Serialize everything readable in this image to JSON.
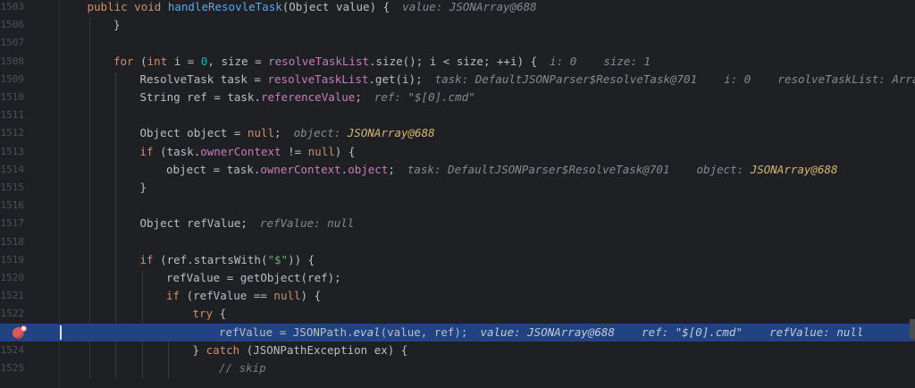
{
  "editor": {
    "lines": [
      {
        "num": "1503",
        "indent": 1,
        "tokens": [
          {
            "t": "public void ",
            "c": "kw"
          },
          {
            "t": "handleResovleTask",
            "c": "fn"
          },
          {
            "t": "(Object value) {",
            "c": "plain"
          },
          {
            "t": "value: JSONArray@688",
            "c": "hint"
          }
        ]
      },
      {
        "num": "1506",
        "indent": 2,
        "tokens": [
          {
            "t": "}",
            "c": "plain"
          }
        ]
      },
      {
        "num": "1507",
        "indent": 0,
        "tokens": []
      },
      {
        "num": "1508",
        "indent": 2,
        "tokens": [
          {
            "t": "for ",
            "c": "kw"
          },
          {
            "t": "(",
            "c": "plain"
          },
          {
            "t": "int ",
            "c": "kw"
          },
          {
            "t": "i = ",
            "c": "plain"
          },
          {
            "t": "0",
            "c": "num-lit"
          },
          {
            "t": ", size = ",
            "c": "plain"
          },
          {
            "t": "resolveTaskList",
            "c": "field"
          },
          {
            "t": ".size(); i < size; ++i) {",
            "c": "plain"
          },
          {
            "t": "i: 0    size: 1",
            "c": "hint"
          }
        ]
      },
      {
        "num": "1509",
        "indent": 3,
        "tokens": [
          {
            "t": "ResolveTask task = ",
            "c": "plain"
          },
          {
            "t": "resolveTaskList",
            "c": "field"
          },
          {
            "t": ".get(i);",
            "c": "plain"
          },
          {
            "t": "task: DefaultJSONParser$ResolveTask@701    i: 0    resolveTaskList: ArrayL",
            "c": "hint"
          }
        ]
      },
      {
        "num": "1510",
        "indent": 3,
        "tokens": [
          {
            "t": "String ref = task.",
            "c": "plain"
          },
          {
            "t": "referenceValue",
            "c": "field"
          },
          {
            "t": ";",
            "c": "plain"
          },
          {
            "t": "ref: \"$[0].cmd\"",
            "c": "hint"
          }
        ]
      },
      {
        "num": "1511",
        "indent": 0,
        "tokens": []
      },
      {
        "num": "1512",
        "indent": 3,
        "tokens": [
          {
            "t": "Object object = ",
            "c": "plain"
          },
          {
            "t": "null",
            "c": "kw"
          },
          {
            "t": ";",
            "c": "plain"
          },
          {
            "t": "object: ",
            "c": "hint"
          },
          {
            "t": "JSONArray@688",
            "c": "hint-obj"
          }
        ]
      },
      {
        "num": "1513",
        "indent": 3,
        "tokens": [
          {
            "t": "if ",
            "c": "kw"
          },
          {
            "t": "(task.",
            "c": "plain"
          },
          {
            "t": "ownerContext",
            "c": "field"
          },
          {
            "t": " != ",
            "c": "plain"
          },
          {
            "t": "null",
            "c": "kw"
          },
          {
            "t": ") {",
            "c": "plain"
          }
        ]
      },
      {
        "num": "1514",
        "indent": 4,
        "tokens": [
          {
            "t": "object = task.",
            "c": "plain"
          },
          {
            "t": "ownerContext",
            "c": "field"
          },
          {
            "t": ".",
            "c": "plain"
          },
          {
            "t": "object",
            "c": "field"
          },
          {
            "t": ";",
            "c": "plain"
          },
          {
            "t": "task: DefaultJSONParser$ResolveTask@701    object: ",
            "c": "hint"
          },
          {
            "t": "JSONArray@688",
            "c": "hint-obj"
          }
        ]
      },
      {
        "num": "1515",
        "indent": 3,
        "tokens": [
          {
            "t": "}",
            "c": "plain"
          }
        ]
      },
      {
        "num": "1516",
        "indent": 0,
        "tokens": []
      },
      {
        "num": "1517",
        "indent": 3,
        "tokens": [
          {
            "t": "Object refValue;",
            "c": "plain"
          },
          {
            "t": "refValue: null",
            "c": "hint"
          }
        ]
      },
      {
        "num": "1518",
        "indent": 0,
        "tokens": []
      },
      {
        "num": "1519",
        "indent": 3,
        "tokens": [
          {
            "t": "if ",
            "c": "kw"
          },
          {
            "t": "(ref.startsWith(",
            "c": "plain"
          },
          {
            "t": "\"$\"",
            "c": "str"
          },
          {
            "t": ")) {",
            "c": "plain"
          }
        ]
      },
      {
        "num": "1520",
        "indent": 4,
        "tokens": [
          {
            "t": "refValue = getObject(ref);",
            "c": "plain"
          }
        ]
      },
      {
        "num": "1521",
        "indent": 4,
        "tokens": [
          {
            "t": "if ",
            "c": "kw"
          },
          {
            "t": "(refValue == ",
            "c": "plain"
          },
          {
            "t": "null",
            "c": "kw"
          },
          {
            "t": ") {",
            "c": "plain"
          }
        ]
      },
      {
        "num": "1522",
        "indent": 5,
        "tokens": [
          {
            "t": "try ",
            "c": "kw"
          },
          {
            "t": "{",
            "c": "plain"
          }
        ]
      },
      {
        "num": "",
        "indent": 6,
        "current": true,
        "breakpoint": true,
        "tokens": [
          {
            "t": "refValue = JSONPath.",
            "c": "plain"
          },
          {
            "t": "eval",
            "c": "hint-val"
          },
          {
            "t": "(value, ref);",
            "c": "plain"
          },
          {
            "t": "value: JSONArray@688    ref: \"$[0].cmd\"    refValue: null",
            "c": "hint"
          }
        ]
      },
      {
        "num": "1524",
        "indent": 5,
        "tokens": [
          {
            "t": "} ",
            "c": "plain"
          },
          {
            "t": "catch ",
            "c": "kw"
          },
          {
            "t": "(JSONPathException ex) {",
            "c": "plain"
          }
        ]
      },
      {
        "num": "1525",
        "indent": 6,
        "tokens": [
          {
            "t": "// skip",
            "c": "cmt"
          }
        ]
      }
    ]
  }
}
